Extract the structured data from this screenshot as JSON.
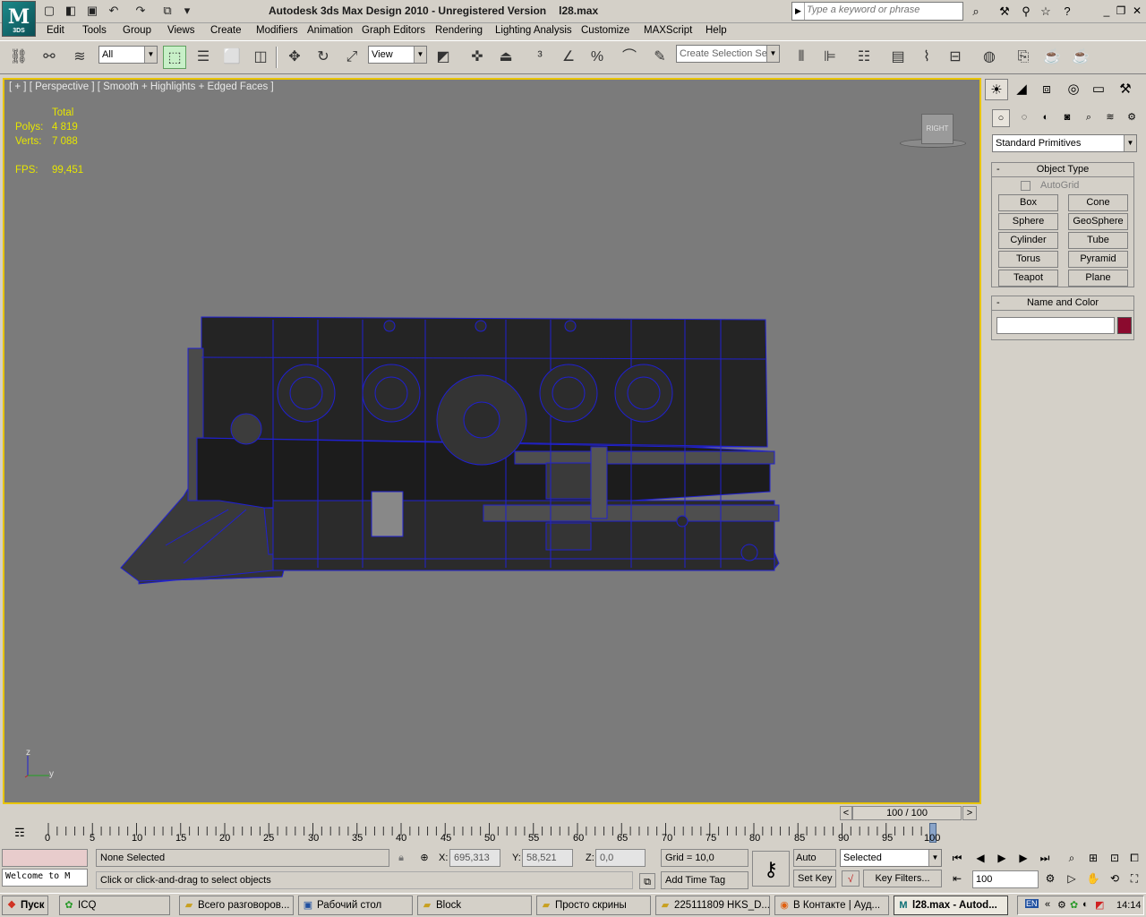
{
  "app": {
    "logo_text": "M",
    "logo_sub": "3DS",
    "title": "Autodesk 3ds Max Design 2010  -  Unregistered Version",
    "file": "l28.max",
    "search_placeholder": "Type a keyword or phrase"
  },
  "menus": [
    "Edit",
    "Tools",
    "Group",
    "Views",
    "Create",
    "Modifiers",
    "Animation",
    "Graph Editors",
    "Rendering",
    "Lighting Analysis",
    "Customize",
    "MAXScript",
    "Help"
  ],
  "toolbar": {
    "filter_value": "All",
    "refcoord_value": "View",
    "selection_set_placeholder": "Create Selection Se"
  },
  "viewport": {
    "label": "[ + ] [ Perspective ] [ Smooth + Highlights + Edged Faces ]",
    "stats": {
      "header": "Total",
      "polys_label": "Polys:",
      "polys_value": "4 819",
      "verts_label": "Verts:",
      "verts_value": "7 088",
      "fps_label": "FPS:",
      "fps_value": "99,451"
    },
    "viewcube_label": "RIGHT",
    "axis_z": "z",
    "axis_y": "y"
  },
  "command_panel": {
    "category": "Standard Primitives",
    "object_type_title": "Object Type",
    "autogrid_label": "AutoGrid",
    "primitives": [
      "Box",
      "Cone",
      "Sphere",
      "GeoSphere",
      "Cylinder",
      "Tube",
      "Torus",
      "Pyramid",
      "Teapot",
      "Plane"
    ],
    "name_color_title": "Name and Color",
    "name_value": "",
    "object_color": "#8b0a2e"
  },
  "timeline": {
    "frame_display": "100 / 100",
    "ticks": [
      "0",
      "5",
      "10",
      "15",
      "20",
      "25",
      "30",
      "35",
      "40",
      "45",
      "50",
      "55",
      "60",
      "65",
      "70",
      "75",
      "80",
      "85",
      "90",
      "95",
      "100"
    ]
  },
  "status": {
    "maxscript_listener": "Welcome to M",
    "selection_text": "None Selected",
    "prompt_text": "Click or click-and-drag to select objects",
    "x_label": "X:",
    "x_value": "695,313",
    "y_label": "Y:",
    "y_value": "58,521",
    "z_label": "Z:",
    "z_value": "0,0",
    "grid_text": "Grid = 10,0",
    "add_time_tag": "Add Time Tag",
    "auto_key": "Auto Key",
    "set_key": "Set Key",
    "key_mode_value": "Selected",
    "key_filters": "Key Filters...",
    "current_frame": "100"
  },
  "taskbar": {
    "start_label": "Пуск",
    "tasks": [
      "ICQ",
      "Всего разговоров...",
      "Рабочий стол",
      "Block",
      "Просто скрины",
      "225111809 HKS_D...",
      "В Контакте | Ауд...",
      "l28.max - Autod..."
    ],
    "lang": "EN",
    "clock": "14:14"
  }
}
